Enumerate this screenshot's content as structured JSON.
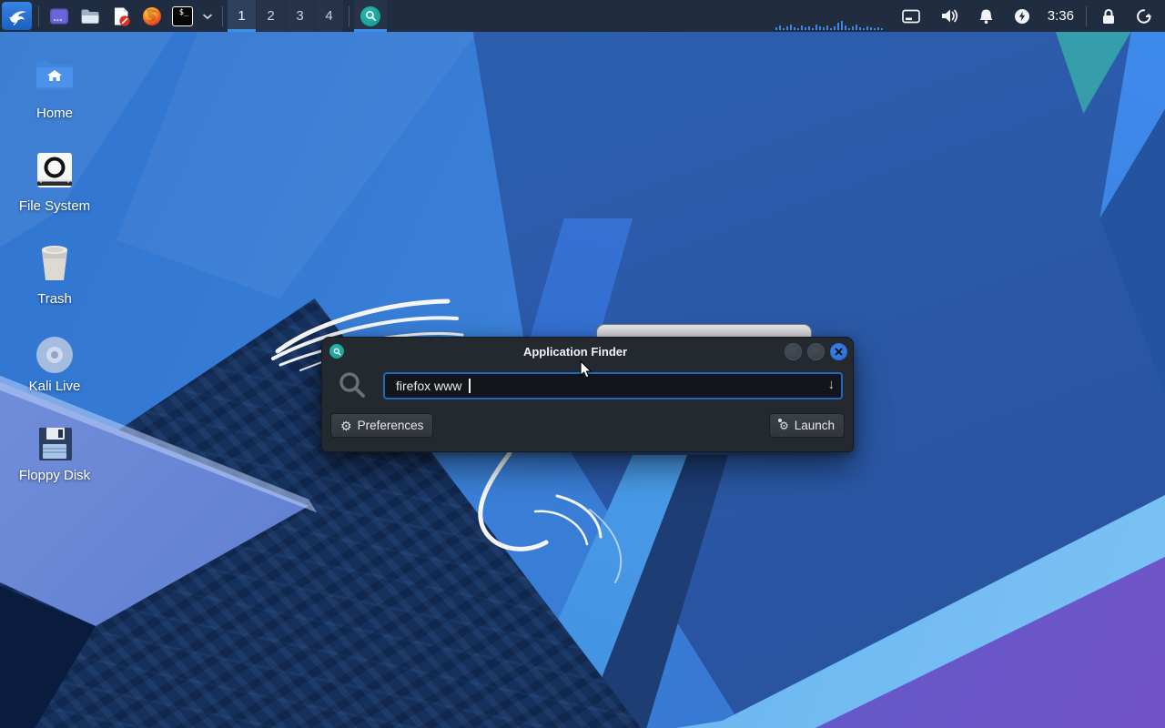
{
  "panel": {
    "launchers": {
      "kali_menu": "kali-whisker-menu",
      "terminal_emulator_glyph": "$_"
    },
    "workspaces": {
      "items": [
        "1",
        "2",
        "3",
        "4"
      ],
      "active": "1"
    },
    "clock": "3:36",
    "monitor_bars": [
      3,
      5,
      2,
      4,
      6,
      3,
      2,
      5,
      3,
      4,
      2,
      6,
      4,
      3,
      5,
      2,
      4,
      8,
      10,
      5,
      2,
      4,
      6,
      3,
      2,
      4,
      3,
      2,
      3,
      2
    ]
  },
  "desktop": {
    "icons": [
      {
        "label": "Home"
      },
      {
        "label": "File System"
      },
      {
        "label": "Trash"
      },
      {
        "label": "Kali Live"
      },
      {
        "label": "Floppy Disk"
      }
    ]
  },
  "finder": {
    "title": "Application Finder",
    "search_value": "firefox www",
    "preferences_label": "Preferences",
    "launch_label": "Launch",
    "drop_arrow": "↓",
    "gear_glyph": "⚙"
  },
  "colors": {
    "accent": "#2d74dc",
    "panel": "#20293a",
    "teal": "#14a09a",
    "underline": "#3f8ee8"
  }
}
